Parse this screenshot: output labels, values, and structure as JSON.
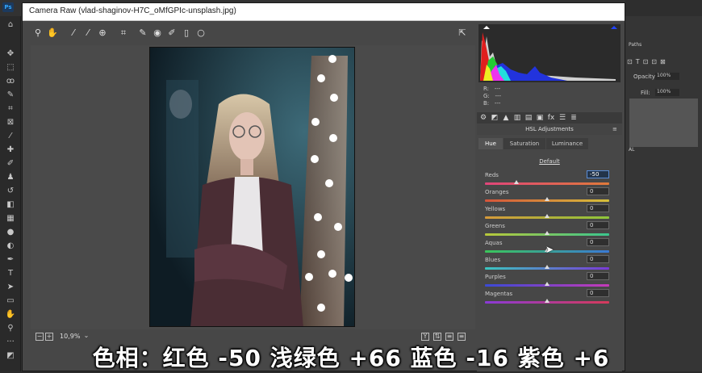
{
  "window": {
    "title": "Camera Raw (vlad-shaginov-H7C_oMfGPIc-unsplash.jpg)",
    "app_logo": "Ps"
  },
  "ps_right_panel": {
    "paths_label": "Paths",
    "opacity_label": "Opacity:",
    "opacity_value": "100%",
    "fill_label": "Fill:",
    "fill_value": "100%",
    "layer_label": "AL"
  },
  "status": {
    "zoom": "10,9%"
  },
  "readout": {
    "r_label": "R:",
    "g_label": "G:",
    "b_label": "B:",
    "r": "---",
    "g": "---",
    "b": "---"
  },
  "hsl": {
    "title": "HSL Adjustments",
    "tabs": [
      "Hue",
      "Saturation",
      "Luminance"
    ],
    "active_tab": "Hue",
    "default_label": "Default",
    "sliders": [
      {
        "label": "Reds",
        "value": "-50",
        "level": 0.25,
        "gradient": [
          "#e0457a",
          "#e07a3a"
        ]
      },
      {
        "label": "Oranges",
        "value": "0",
        "level": 0.5,
        "gradient": [
          "#d6543a",
          "#d6c03a"
        ]
      },
      {
        "label": "Yellows",
        "value": "0",
        "level": 0.5,
        "gradient": [
          "#d69a3a",
          "#8ec63a"
        ]
      },
      {
        "label": "Greens",
        "value": "0",
        "level": 0.5,
        "gradient": [
          "#b8c83a",
          "#3ac68e"
        ]
      },
      {
        "label": "Aquas",
        "value": "0",
        "level": 0.5,
        "gradient": [
          "#3ac65a",
          "#3a7ad6"
        ]
      },
      {
        "label": "Blues",
        "value": "0",
        "level": 0.5,
        "gradient": [
          "#3ac6c0",
          "#7a3ad6"
        ]
      },
      {
        "label": "Purples",
        "value": "0",
        "level": 0.5,
        "gradient": [
          "#3a4ad6",
          "#c63ab8"
        ]
      },
      {
        "label": "Magentas",
        "value": "0",
        "level": 0.5,
        "gradient": [
          "#8a3ad6",
          "#d63a5a"
        ]
      }
    ]
  },
  "caption": "色相：红色 -50 浅绿色 +66 蓝色 -16 紫色 +6"
}
